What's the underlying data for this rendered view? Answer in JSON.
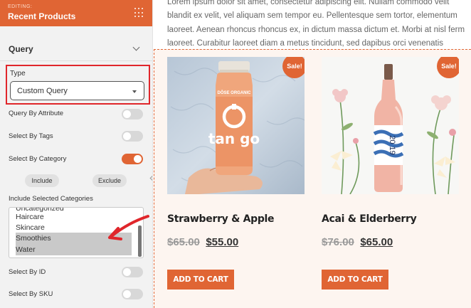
{
  "sidebar": {
    "editing_label": "EDITING:",
    "title": "Recent Products",
    "section_title": "Query",
    "type": {
      "label": "Type",
      "value": "Custom Query"
    },
    "rows": {
      "query_by_attribute": {
        "label": "Query By Attribute",
        "on": false
      },
      "select_by_tags": {
        "label": "Select By Tags",
        "on": false
      },
      "select_by_category": {
        "label": "Select By Category",
        "on": true
      },
      "select_by_id": {
        "label": "Select By ID",
        "on": false
      },
      "select_by_sku": {
        "label": "Select By SKU",
        "on": false
      }
    },
    "include_label": "Include",
    "exclude_label": "Exclude",
    "categories_label": "Include Selected Categories",
    "categories": [
      {
        "label": "Uncategorized",
        "selected": false
      },
      {
        "label": "Haircare",
        "selected": false
      },
      {
        "label": "Skincare",
        "selected": false
      },
      {
        "label": "Smoothies",
        "selected": true
      },
      {
        "label": "Water",
        "selected": true
      }
    ]
  },
  "main": {
    "paragraph_lines": [
      "Lorem ipsum dolor sit amet, consectetur adipiscing elit. Nullam commodo velit",
      "blandit ex velit, vel aliquam sem tempor eu. Pellentesque sem tortor, elementum",
      "laoreet. Aenean rhoncus rhoncus ex, in dictum massa dictum et. Morbi at nisl ferm",
      "laoreet. Curabitur laoreet diam a metus tincidunt, sed dapibus orci venenatis"
    ],
    "products": [
      {
        "name": "Strawberry & Apple",
        "old_price": "$65.00",
        "new_price": "$55.00",
        "badge": "Sale!",
        "bottle_brand": "DŌSE ORGANIC",
        "bottle_text": "tan go",
        "cta": "ADD TO CART"
      },
      {
        "name": "Acai & Elderberry",
        "old_price": "$76.00",
        "new_price": "$65.00",
        "badge": "Sale!",
        "bottle_label": "20 19",
        "cta": "ADD TO CART"
      }
    ]
  },
  "colors": {
    "accent": "#e06534",
    "highlight_box": "#e0262b",
    "product_bg": "#fdf5f0"
  }
}
